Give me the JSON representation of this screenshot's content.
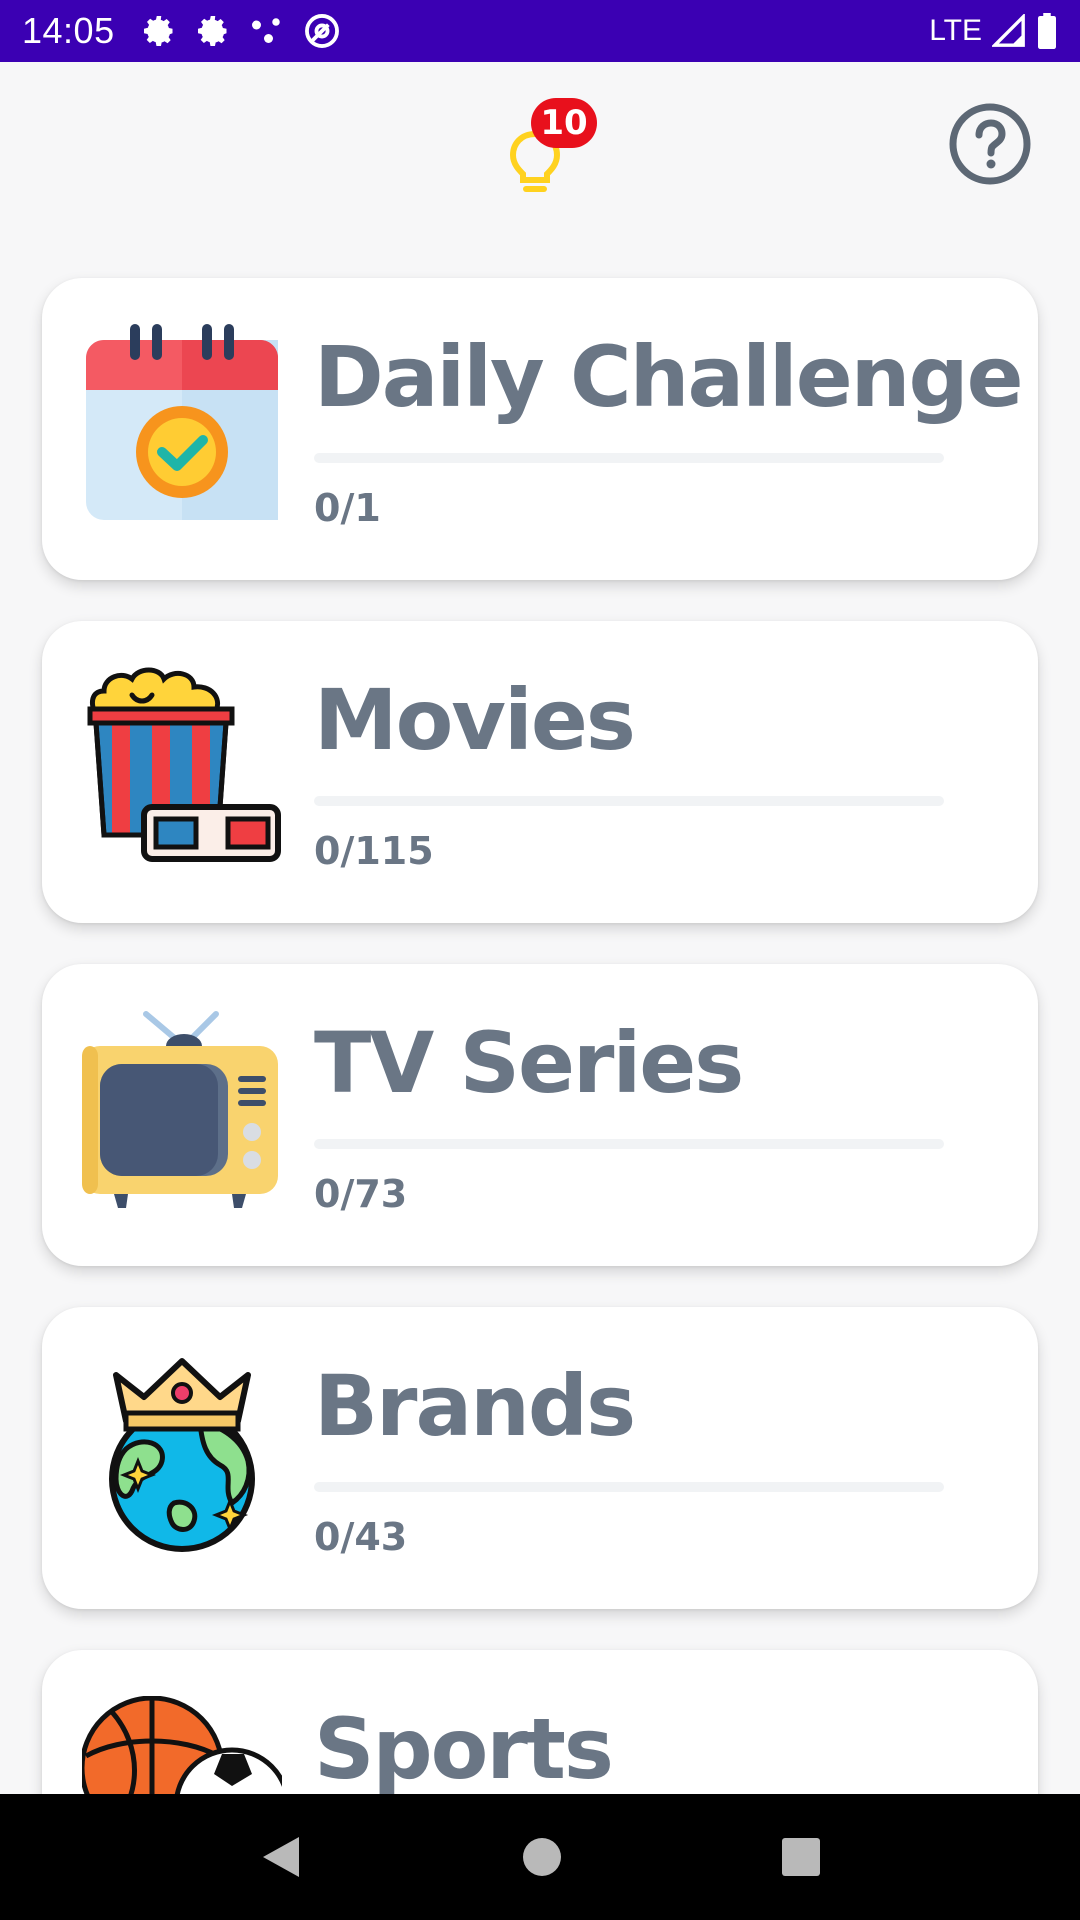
{
  "status_bar": {
    "time": "14:05",
    "network": "LTE",
    "icons": [
      "gear-icon",
      "gear-icon",
      "dots-icon",
      "at-sign-icon",
      "signal-icon",
      "battery-icon"
    ]
  },
  "header": {
    "hint_count": "10",
    "hint_icon": "lightbulb-icon",
    "help_icon": "question-circle-icon"
  },
  "categories": [
    {
      "title": "Daily Challenge",
      "progress": "0/1",
      "completed": 0,
      "total": 1,
      "icon": "calendar-check-icon"
    },
    {
      "title": "Movies",
      "progress": "0/115",
      "completed": 0,
      "total": 115,
      "icon": "popcorn-3d-glasses-icon"
    },
    {
      "title": "TV Series",
      "progress": "0/73",
      "completed": 0,
      "total": 73,
      "icon": "retro-tv-icon"
    },
    {
      "title": "Brands",
      "progress": "0/43",
      "completed": 0,
      "total": 43,
      "icon": "crowned-globe-icon"
    },
    {
      "title": "Sports",
      "icon": "sports-balls-icon"
    }
  ],
  "colors": {
    "status_bar": "#3b00b3",
    "badge": "#e8101c",
    "text": "#6a7685",
    "bulb": "#ffd21f"
  }
}
